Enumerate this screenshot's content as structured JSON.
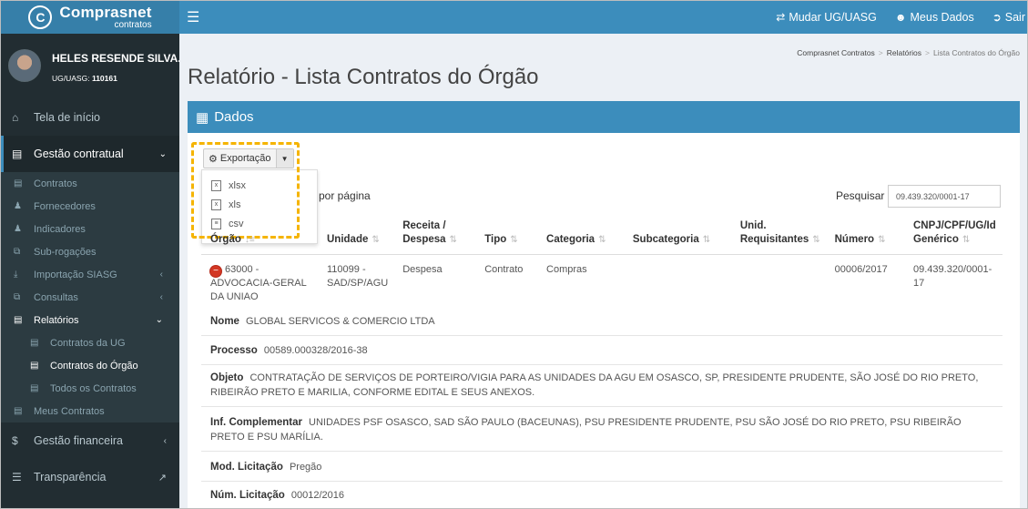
{
  "header": {
    "logo_main": "Comprasnet",
    "logo_sub": "contratos",
    "nav": [
      {
        "label": "Mudar UG/UASG",
        "icon": "exchange-icon"
      },
      {
        "label": "Meus Dados",
        "icon": "user-circle-icon"
      },
      {
        "label": "Sair",
        "icon": "sign-out-icon"
      }
    ]
  },
  "user": {
    "name": "HELES RESENDE SILVA...",
    "uasg_label": "UG/UASG:",
    "uasg_code": "110161"
  },
  "sidebar": {
    "home": "Tela de início",
    "gestao_contratual": "Gestão contratual",
    "items": [
      "Contratos",
      "Fornecedores",
      "Indicadores",
      "Sub-rogações",
      "Importação SIASG",
      "Consultas",
      "Relatórios"
    ],
    "relatorios_sub": [
      "Contratos da UG",
      "Contratos do Órgão",
      "Todos os Contratos"
    ],
    "meus_contratos": "Meus Contratos",
    "gestao_financeira": "Gestão financeira",
    "transparencia": "Transparência"
  },
  "breadcrumb": [
    "Comprasnet Contratos",
    "Relatórios",
    "Lista Contratos do Órgão"
  ],
  "page": {
    "title": "Relatório - Lista Contratos do Órgão",
    "box_title": "Dados"
  },
  "toolbar": {
    "export_label": "Exportação",
    "export_options": [
      "xlsx",
      "xls",
      "csv"
    ],
    "per_page_label": "por página",
    "search_label": "Pesquisar",
    "search_value": "09.439.320/0001-17"
  },
  "table": {
    "columns": [
      "Órgão",
      "Unidade",
      "Receita / Despesa",
      "Tipo",
      "Categoria",
      "Subcategoria",
      "Unid. Requisitantes",
      "Número",
      "CNPJ/CPF/UG/Id Genérico"
    ],
    "row": [
      "63000 - ADVOCACIA-GERAL DA UNIAO",
      "110099 - SAD/SP/AGU",
      "Despesa",
      "Contrato",
      "Compras",
      "",
      "",
      "00006/2017",
      "09.439.320/0001-17"
    ]
  },
  "details": [
    {
      "label": "Nome",
      "value": "GLOBAL SERVICOS & COMERCIO LTDA"
    },
    {
      "label": "Processo",
      "value": "00589.000328/2016-38"
    },
    {
      "label": "Objeto",
      "value": "CONTRATAÇÃO DE SERVIÇOS DE PORTEIRO/VIGIA PARA AS UNIDADES DA AGU EM OSASCO, SP, PRESIDENTE PRUDENTE, SÃO JOSÉ DO RIO PRETO, RIBEIRÃO PRETO E MARILIA, CONFORME EDITAL E SEUS ANEXOS."
    },
    {
      "label": "Inf. Complementar",
      "value": "UNIDADES PSF OSASCO, SAD SÃO PAULO (BACEUNAS), PSU PRESIDENTE PRUDENTE, PSU SÃO JOSÉ DO RIO PRETO, PSU RIBEIRÃO PRETO E PSU MARÍLIA."
    },
    {
      "label": "Mod. Licitação",
      "value": "Pregão"
    },
    {
      "label": "Núm. Licitação",
      "value": "00012/2016"
    }
  ]
}
